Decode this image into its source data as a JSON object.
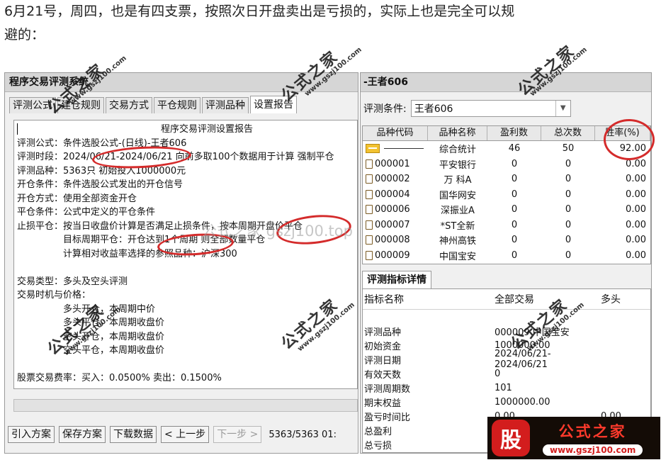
{
  "article": {
    "line1": "6月21号，周四，也是有四支票，按照次日开盘卖出是亏损的，实际上也是完全可以规",
    "line2": "避的："
  },
  "left_window": {
    "title": "程序交易评测系统",
    "tabs": [
      "评测公式",
      "建仓规则",
      "交易方式",
      "平仓规则",
      "评测品种",
      "设置报告"
    ],
    "report": {
      "title": "程序交易评测设置报告",
      "lines": [
        "评测公式：条件选股公式-(日线)-王者606",
        "评测时段：2024/06/21-2024/06/21 向前多取100个数据用于计算 强制平仓",
        "评测品种：5363只 初始投入1000000元",
        "开仓条件：条件选股公式发出的开仓信号",
        "开仓方式：使用全部资金开仓",
        "平仓条件：公式中定义的平仓条件",
        "止损平仓：按当日收盘价计算是否满足止损条件，按本周期开盘价平仓",
        "　　　　　目标周期平仓：开仓达到1个周期 则全部数量平仓",
        "　　　　　计算相对收益率选择的参照品种：沪深300",
        "",
        "交易类型：多头及空头评测",
        "交易时机与价格：",
        "　　　　　多头开仓，本周期中价",
        "　　　　　多头平仓，本周期收盘价",
        "　　　　　空头开仓，本周期收盘价",
        "　　　　　空头平仓，本周期收盘价",
        "",
        "股票交易费率：买入：0.0500% 卖出：0.1500%"
      ]
    },
    "buttons": {
      "import": "引入方案",
      "save": "保存方案",
      "download": "下载数据",
      "prev": "< 上一步",
      "next": "下一步 >"
    },
    "status_count": "5363/5363 01:",
    "icons": {
      "caret": "text-caret"
    }
  },
  "right_window": {
    "title": "-王者606",
    "condition_label": "评测条件:",
    "condition_value": "王者606",
    "table": {
      "headers": [
        "品种代码",
        "品种名称",
        "盈利数",
        "总次数",
        "胜率(%)"
      ],
      "rows": [
        {
          "code": "",
          "name": "综合统计",
          "win": "46",
          "total": "50",
          "rate": "92.00",
          "icon": "folder-icon"
        },
        {
          "code": "000001",
          "name": "平安银行",
          "win": "0",
          "total": "0",
          "rate": "0.00",
          "icon": "document-icon"
        },
        {
          "code": "000002",
          "name": "万 科A",
          "win": "0",
          "total": "0",
          "rate": "0.00",
          "icon": "document-icon"
        },
        {
          "code": "000004",
          "name": "国华网安",
          "win": "0",
          "total": "0",
          "rate": "0.00",
          "icon": "document-icon"
        },
        {
          "code": "000006",
          "name": "深振业A",
          "win": "0",
          "total": "0",
          "rate": "0.00",
          "icon": "document-icon"
        },
        {
          "code": "000007",
          "name": "*ST全新",
          "win": "0",
          "total": "0",
          "rate": "0.00",
          "icon": "document-icon"
        },
        {
          "code": "000008",
          "name": "神州高铁",
          "win": "0",
          "total": "0",
          "rate": "0.00",
          "icon": "document-icon"
        },
        {
          "code": "000009",
          "name": "中国宝安",
          "win": "0",
          "total": "0",
          "rate": "0.00",
          "icon": "document-icon"
        }
      ]
    },
    "detail_tab": "评测指标详情",
    "detail": {
      "headers": [
        "指标名称",
        "全部交易",
        "多头"
      ],
      "rows": [
        {
          "name": "",
          "all": "",
          "long": ""
        },
        {
          "name": "评测品种",
          "all": "000009 中国宝安",
          "long": ""
        },
        {
          "name": "初始资金",
          "all": "1000000.00",
          "long": ""
        },
        {
          "name": "评测日期",
          "all": "2024/06/21-2024/06/21",
          "long": ""
        },
        {
          "name": "有效天数",
          "all": "0",
          "long": ""
        },
        {
          "name": "评测周期数",
          "all": "101",
          "long": ""
        },
        {
          "name": "期末权益",
          "all": "1000000.00",
          "long": ""
        },
        {
          "name": "盈亏时间比",
          "all": "0.00",
          "long": "0.00"
        },
        {
          "name": "总盈利",
          "all": "",
          "long": ""
        },
        {
          "name": "总亏损",
          "all": "",
          "long": ""
        }
      ]
    }
  },
  "watermarks": {
    "brand": "公式之家",
    "url": "www.gszj100.com",
    "center": "公式之家 gszj100.top"
  },
  "logo": {
    "badge": "股",
    "main": "公式之家",
    "url": "www.gszj100.com"
  },
  "colors": {
    "annotation_red": "#d42b2b",
    "logo_bg": "#140c06",
    "logo_red": "#d31d1d"
  }
}
